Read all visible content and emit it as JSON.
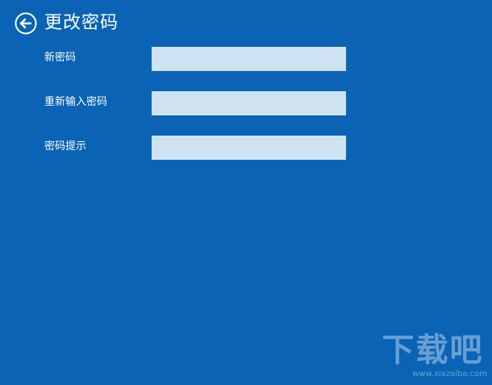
{
  "header": {
    "title": "更改密码",
    "back_icon": "back-arrow-circle-icon"
  },
  "form": {
    "fields": [
      {
        "label": "新密码",
        "value": ""
      },
      {
        "label": "重新输入密码",
        "value": ""
      },
      {
        "label": "密码提示",
        "value": ""
      }
    ]
  },
  "watermark": {
    "logo_text": "下载吧",
    "url": "www.xiazaiba.com"
  },
  "colors": {
    "background": "#0a63b4",
    "input_background": "#cfe2f2",
    "text": "#ffffff"
  }
}
